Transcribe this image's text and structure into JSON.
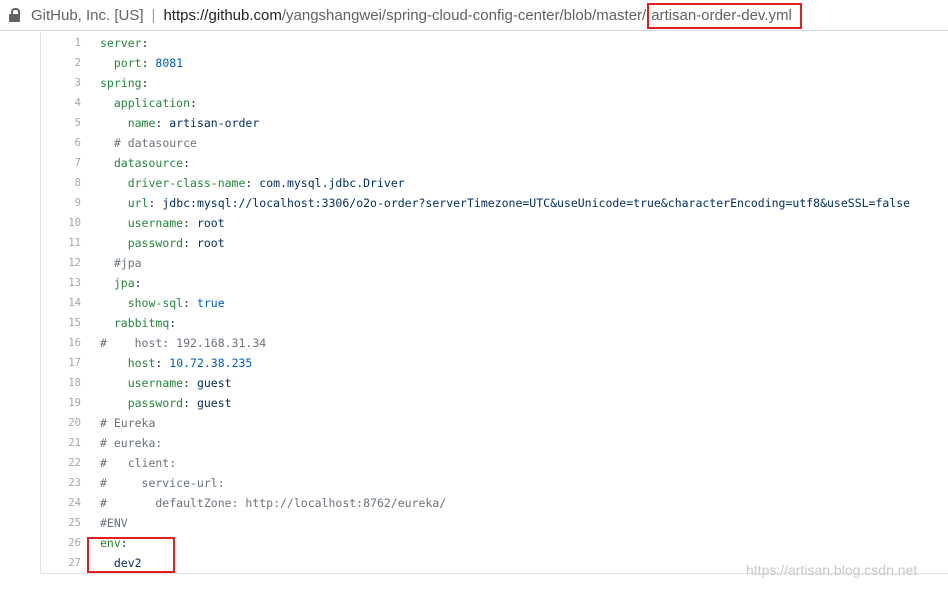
{
  "browser": {
    "site_identity": "GitHub, Inc. [US]",
    "separator": "|",
    "url_host": "https://github.com",
    "url_path": "/yangshangwei/spring-cloud-config-center/blob/master/",
    "url_file": "artisan-order-dev.yml"
  },
  "code_lines": [
    {
      "n": "1",
      "indent": "",
      "key": "server",
      "colon": ":",
      "value": "",
      "vtype": ""
    },
    {
      "n": "2",
      "indent": "  ",
      "key": "port",
      "colon": ":",
      "value": " 8081",
      "vtype": "n"
    },
    {
      "n": "3",
      "indent": "",
      "key": "spring",
      "colon": ":",
      "value": "",
      "vtype": ""
    },
    {
      "n": "4",
      "indent": "  ",
      "key": "application",
      "colon": ":",
      "value": "",
      "vtype": ""
    },
    {
      "n": "5",
      "indent": "    ",
      "key": "name",
      "colon": ":",
      "value": " artisan-order",
      "vtype": "s"
    },
    {
      "n": "6",
      "indent": "  ",
      "comment": "# datasource"
    },
    {
      "n": "7",
      "indent": "  ",
      "key": "datasource",
      "colon": ":",
      "value": "",
      "vtype": ""
    },
    {
      "n": "8",
      "indent": "    ",
      "key": "driver-class-name",
      "colon": ":",
      "value": " com.mysql.jdbc.Driver",
      "vtype": "s"
    },
    {
      "n": "9",
      "indent": "    ",
      "key": "url",
      "colon": ":",
      "value": " jdbc:mysql://localhost:3306/o2o-order?serverTimezone=UTC&useUnicode=true&characterEncoding=utf8&useSSL=false",
      "vtype": "s"
    },
    {
      "n": "10",
      "indent": "    ",
      "key": "username",
      "colon": ":",
      "value": " root",
      "vtype": "s"
    },
    {
      "n": "11",
      "indent": "    ",
      "key": "password",
      "colon": ":",
      "value": " root",
      "vtype": "s"
    },
    {
      "n": "12",
      "indent": "  ",
      "comment": "#jpa"
    },
    {
      "n": "13",
      "indent": "  ",
      "key": "jpa",
      "colon": ":",
      "value": "",
      "vtype": ""
    },
    {
      "n": "14",
      "indent": "    ",
      "key": "show-sql",
      "colon": ":",
      "value": " true",
      "vtype": "n"
    },
    {
      "n": "15",
      "indent": "  ",
      "key": "rabbitmq",
      "colon": ":",
      "value": "",
      "vtype": ""
    },
    {
      "n": "16",
      "indent": "",
      "comment": "#    host: 192.168.31.34"
    },
    {
      "n": "17",
      "indent": "    ",
      "key": "host",
      "colon": ":",
      "value": " 10.72.38.235",
      "vtype": "n"
    },
    {
      "n": "18",
      "indent": "    ",
      "key": "username",
      "colon": ":",
      "value": " guest",
      "vtype": "s"
    },
    {
      "n": "19",
      "indent": "    ",
      "key": "password",
      "colon": ":",
      "value": " guest",
      "vtype": "s"
    },
    {
      "n": "20",
      "indent": "",
      "comment": "# Eureka"
    },
    {
      "n": "21",
      "indent": "",
      "comment": "# eureka:"
    },
    {
      "n": "22",
      "indent": "",
      "comment": "#   client:"
    },
    {
      "n": "23",
      "indent": "",
      "comment": "#     service-url:"
    },
    {
      "n": "24",
      "indent": "",
      "comment": "#       defaultZone: http://localhost:8762/eureka/"
    },
    {
      "n": "25",
      "indent": "",
      "comment": "#ENV"
    },
    {
      "n": "26",
      "indent": "",
      "key": "env",
      "colon": ":",
      "value": "",
      "vtype": ""
    },
    {
      "n": "27",
      "indent": "  ",
      "key": "",
      "colon": "",
      "value": "dev2",
      "vtype": "s"
    }
  ],
  "watermark": "https://artisan.blog.csdn.net",
  "colors": {
    "highlight_border": "#e02020",
    "key": "#22863a",
    "comment": "#6a737d",
    "number": "#005cc5",
    "string": "#032f62"
  }
}
